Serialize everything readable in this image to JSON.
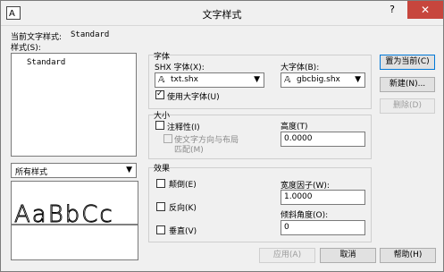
{
  "window": {
    "title": "文字样式",
    "help": "?",
    "close": "✕"
  },
  "current_style": {
    "label": "当前文字样式:",
    "value": "Standard"
  },
  "styles": {
    "label": "样式(S):",
    "items": [
      "Standard"
    ],
    "filter_value": "所有样式"
  },
  "font": {
    "group_title": "字体",
    "shx_label": "SHX 字体(X):",
    "shx_value": "txt.shx",
    "big_label": "大字体(B):",
    "big_value": "gbcbig.shx",
    "use_big_font": "使用大字体(U)",
    "use_big_font_checked": true
  },
  "size": {
    "group_title": "大小",
    "annotative": "注释性(I)",
    "match_orientation_line1": "使文字方向与布局",
    "match_orientation_line2": "匹配(M)",
    "height_label": "高度(T)",
    "height_value": "0.0000"
  },
  "effects": {
    "group_title": "效果",
    "upside_down": "颠倒(E)",
    "backwards": "反向(K)",
    "vertical": "垂直(V)",
    "width_factor_label": "宽度因子(W):",
    "width_factor_value": "1.0000",
    "oblique_label": "倾斜角度(O):",
    "oblique_value": "0"
  },
  "buttons": {
    "set_current": "置为当前(C)",
    "new": "新建(N)...",
    "delete": "删除(D)",
    "apply": "应用(A)",
    "cancel": "取消",
    "help": "帮助(H)"
  },
  "preview": {
    "text": "AaBbCc"
  }
}
